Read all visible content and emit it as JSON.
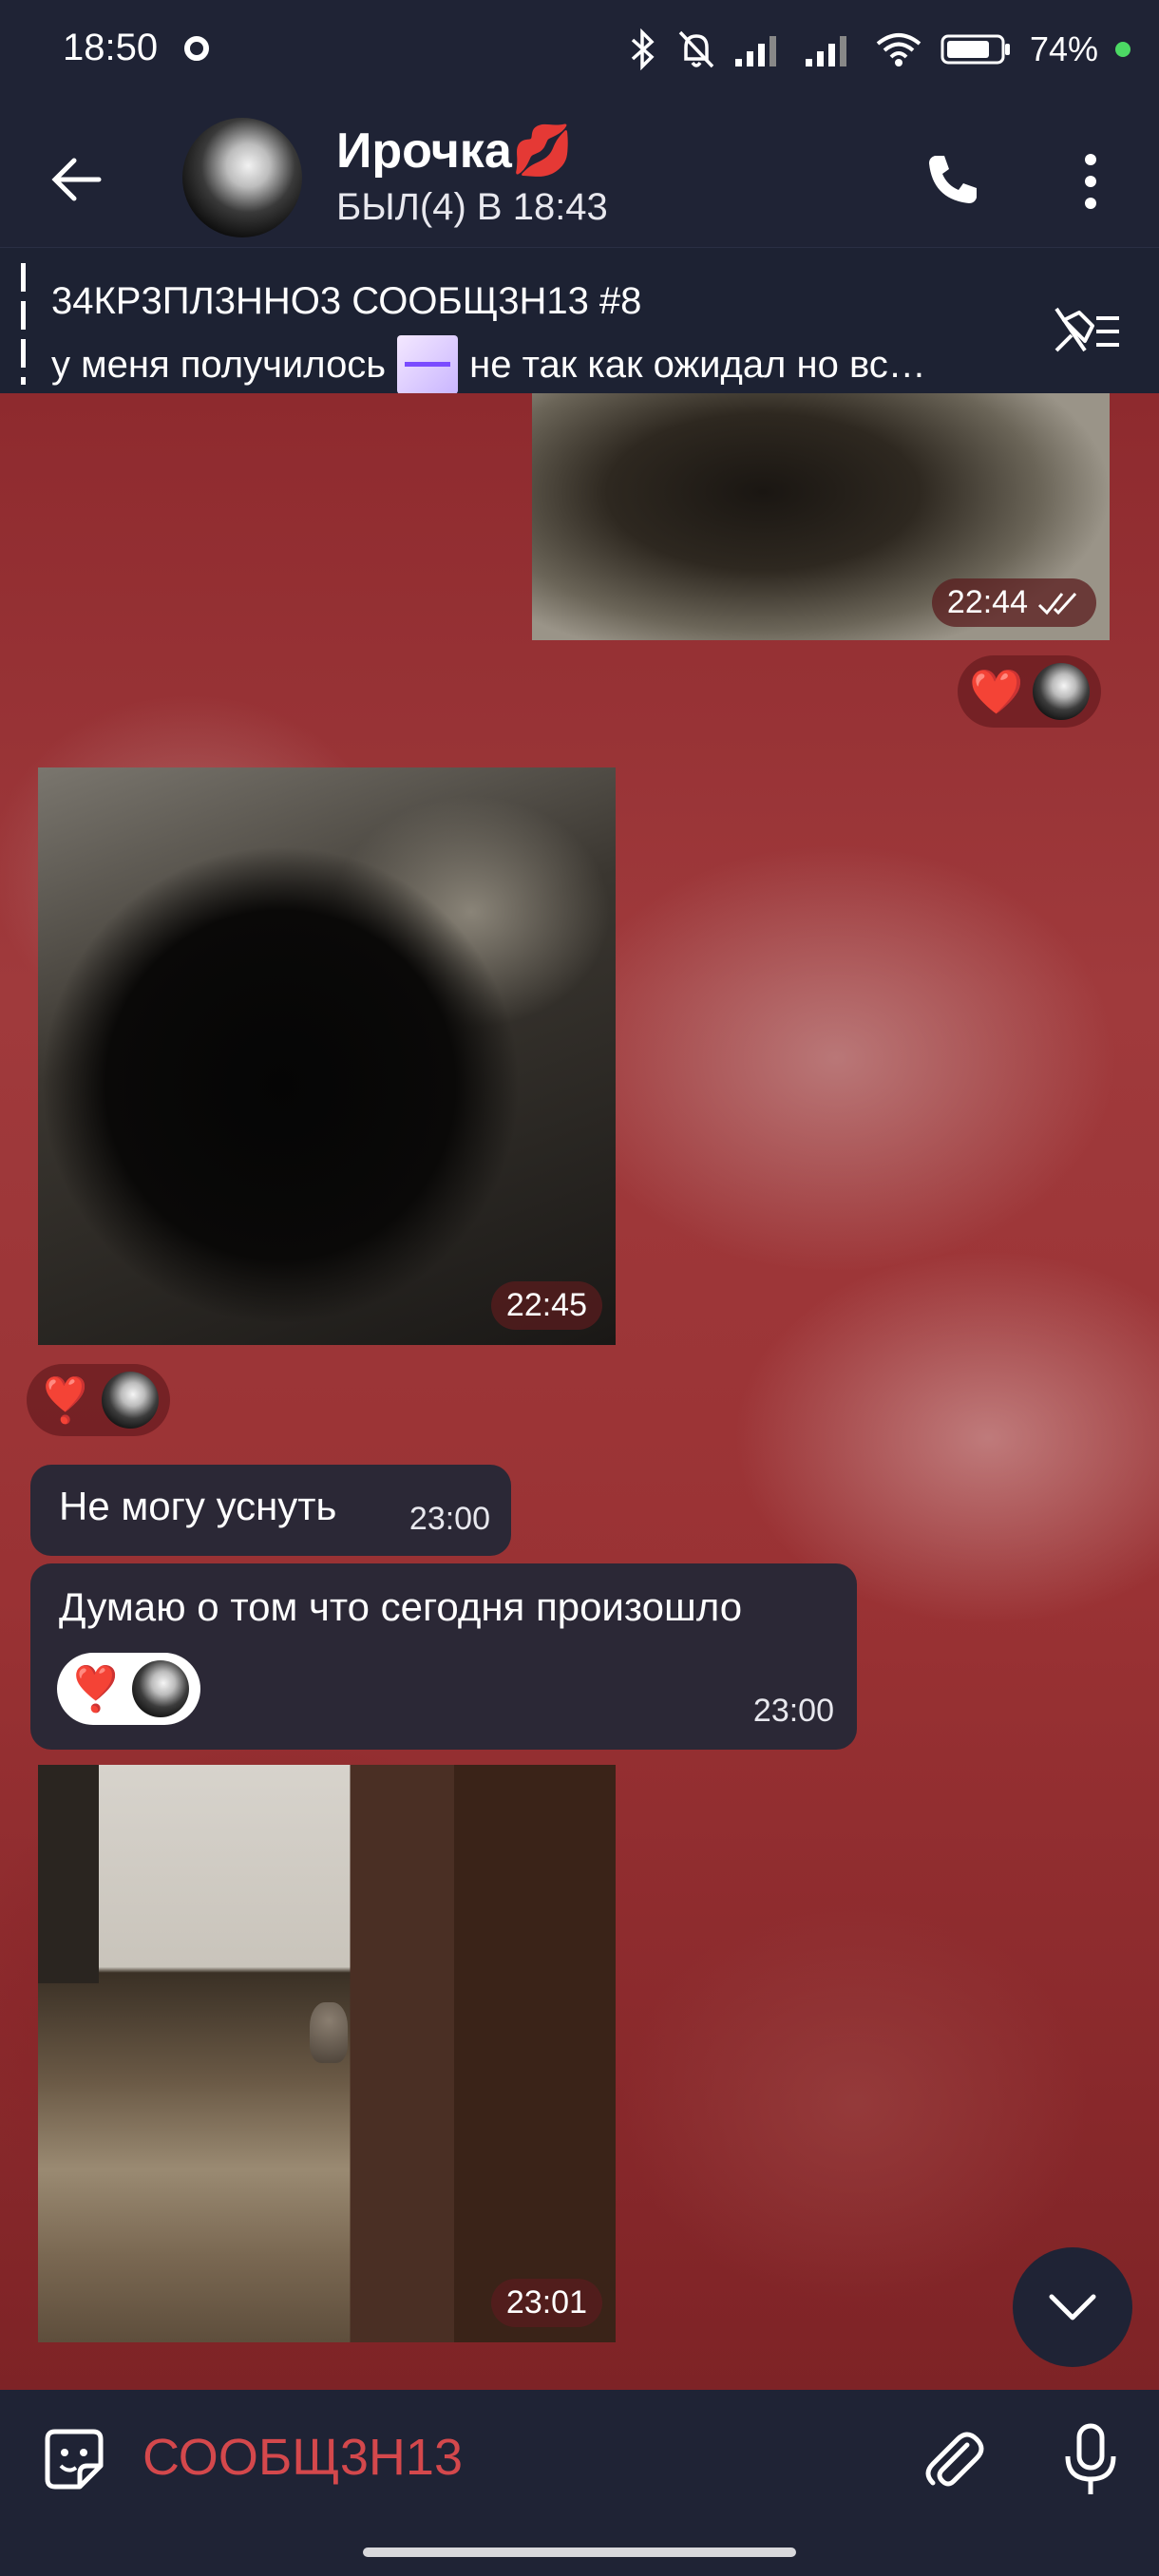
{
  "status_bar": {
    "time": "18:50",
    "battery": "74%"
  },
  "header": {
    "contact_name": "Ирочка💋",
    "last_seen": "БЫЛ(4) В 18:43"
  },
  "pinned": {
    "title": "34КР3ПЛ3ННО3 СООБЩ3Н13 #8",
    "text_before": "у меня получилось",
    "text_after": "не так как ожидал но вс…"
  },
  "messages": {
    "photo1_time": "22:44",
    "photo2_time": "22:45",
    "text1": "Не могу уснуть",
    "text1_time": "23:00",
    "text2": "Думаю о том что сегодня произошло",
    "text2_time": "23:00",
    "photo3_time": "23:01"
  },
  "reactions": {
    "heart": "❤️",
    "hearts": "❣️"
  },
  "input": {
    "placeholder": "СООБЩ3Н13"
  },
  "colors": {
    "accent": "#d4484c",
    "header_bg": "#1f2335",
    "bubble_bg": "#2b2836"
  }
}
